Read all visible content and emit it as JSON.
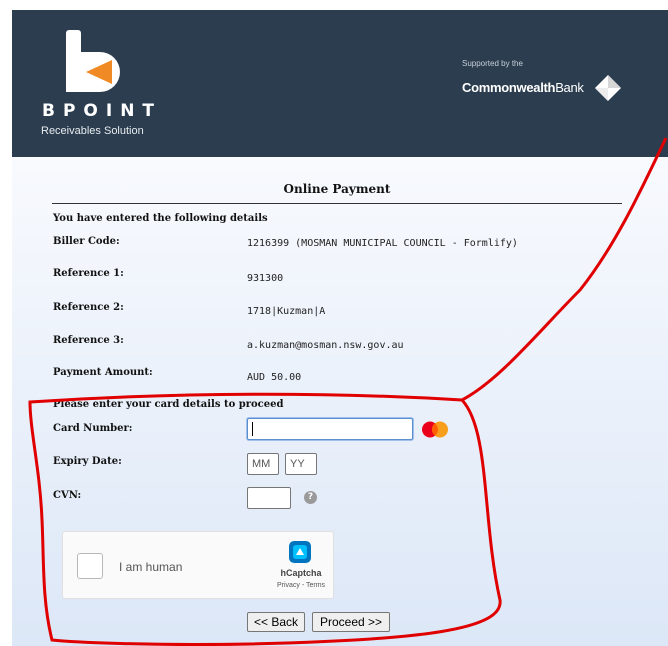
{
  "header": {
    "logo_text": "BPOINT",
    "logo_subtitle": "Receivables Solution",
    "supported_by": "Supported by the",
    "bank_bold": "Commonwealth",
    "bank_regular": "Bank"
  },
  "page_title": "Online Payment",
  "details": {
    "heading": "You have entered the following details",
    "rows": [
      {
        "label": "Biller Code:",
        "value": "1216399 (MOSMAN MUNICIPAL COUNCIL - Formlify)"
      },
      {
        "label": "Reference 1:",
        "value": "931300"
      },
      {
        "label": "Reference 2:",
        "value": "1718|Kuzman|A"
      },
      {
        "label": "Reference 3:",
        "value": "a.kuzman@mosman.nsw.gov.au"
      },
      {
        "label": "Payment Amount:",
        "value": "AUD 50.00"
      }
    ]
  },
  "card": {
    "heading": "Please enter your card details to proceed",
    "card_number_label": "Card Number:",
    "card_number_value": "",
    "expiry_label": "Expiry Date:",
    "expiry_month_placeholder": "MM",
    "expiry_year_placeholder": "YY",
    "cvn_label": "CVN:",
    "cvn_value": "",
    "help_glyph": "?"
  },
  "captcha": {
    "label": "I am human",
    "brand": "hCaptcha",
    "links": "Privacy - Terms"
  },
  "buttons": {
    "back": "<< Back",
    "proceed": "Proceed >>"
  },
  "colors": {
    "header_bg": "#2c3d4f",
    "logo_accent": "#f08a24",
    "annotation": "#e00000"
  },
  "icons": {
    "card_brand": "mastercard-icon",
    "help": "help-icon",
    "captcha": "hcaptcha-logo-icon"
  }
}
